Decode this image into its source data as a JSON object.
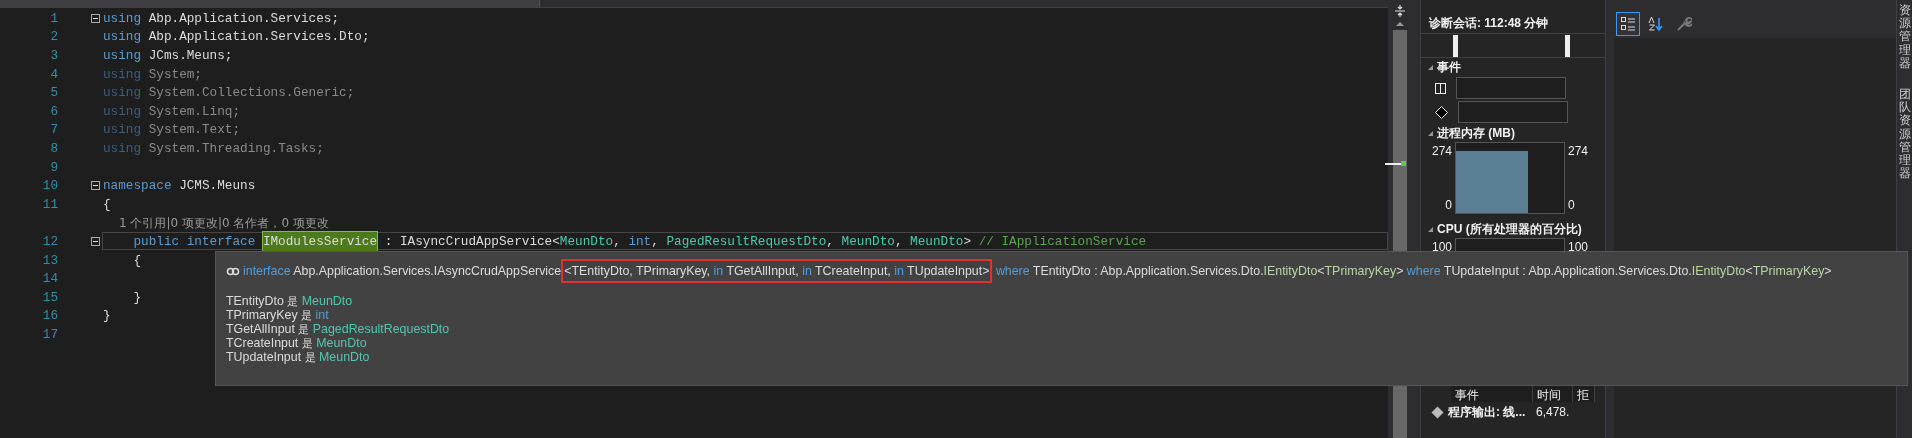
{
  "editor": {
    "lines": [
      {
        "kind": "code",
        "number": "1",
        "fold": true,
        "current": false,
        "tokens": [
          {
            "text": "using",
            "kind": "keyword"
          },
          {
            "text": " Abp.Application.Services;",
            "kind": "plain"
          }
        ]
      },
      {
        "kind": "code",
        "number": "2",
        "fold": false,
        "current": false,
        "tokens": [
          {
            "text": "using",
            "kind": "keyword"
          },
          {
            "text": " Abp.Application.Services.Dto;",
            "kind": "plain"
          }
        ]
      },
      {
        "kind": "code",
        "number": "3",
        "fold": false,
        "current": false,
        "tokens": [
          {
            "text": "using",
            "kind": "keyword"
          },
          {
            "text": " JCms.Meuns;",
            "kind": "plain"
          }
        ]
      },
      {
        "kind": "code",
        "number": "4",
        "fold": false,
        "current": false,
        "tokens": [
          {
            "text": "using",
            "kind": "keyword_dim"
          },
          {
            "text": " System;",
            "kind": "plain_dim"
          }
        ]
      },
      {
        "kind": "code",
        "number": "5",
        "fold": false,
        "current": false,
        "tokens": [
          {
            "text": "using",
            "kind": "keyword_dim"
          },
          {
            "text": " System.Collections.Generic;",
            "kind": "plain_dim"
          }
        ]
      },
      {
        "kind": "code",
        "number": "6",
        "fold": false,
        "current": false,
        "tokens": [
          {
            "text": "using",
            "kind": "keyword_dim"
          },
          {
            "text": " System.Linq;",
            "kind": "plain_dim"
          }
        ]
      },
      {
        "kind": "code",
        "number": "7",
        "fold": false,
        "current": false,
        "tokens": [
          {
            "text": "using",
            "kind": "keyword_dim"
          },
          {
            "text": " System.Text;",
            "kind": "plain_dim"
          }
        ]
      },
      {
        "kind": "code",
        "number": "8",
        "fold": false,
        "current": false,
        "tokens": [
          {
            "text": "using",
            "kind": "keyword_dim"
          },
          {
            "text": " System.Threading.Tasks;",
            "kind": "plain_dim"
          }
        ]
      },
      {
        "kind": "code",
        "number": "9",
        "fold": false,
        "current": false
      },
      {
        "kind": "code",
        "number": "10",
        "fold": true,
        "current": false,
        "tokens": [
          {
            "text": "namespace",
            "kind": "keyword"
          },
          {
            "text": " JCMS.Meuns",
            "kind": "plain"
          }
        ]
      },
      {
        "kind": "code",
        "number": "11",
        "fold": false,
        "current": false,
        "tokens": [
          {
            "text": "{",
            "kind": "plain"
          }
        ]
      },
      {
        "kind": "codelens",
        "text": "1 个引用|0 项更改|0 名作者，0 项更改"
      },
      {
        "kind": "code",
        "number": "12",
        "fold": true,
        "current": true,
        "tokens": [
          {
            "text": "    public interface ",
            "kind": "keyword"
          },
          {
            "text": "IModulesService",
            "kind": "highlight"
          },
          {
            "text": " : IAsyncCrudAppService<",
            "kind": "plain"
          },
          {
            "text": "MeunDto",
            "kind": "type"
          },
          {
            "text": ", ",
            "kind": "plain"
          },
          {
            "text": "int",
            "kind": "keyword"
          },
          {
            "text": ", ",
            "kind": "plain"
          },
          {
            "text": "PagedResultRequestDto",
            "kind": "type"
          },
          {
            "text": ", ",
            "kind": "plain"
          },
          {
            "text": "MeunDto",
            "kind": "type"
          },
          {
            "text": ", ",
            "kind": "plain"
          },
          {
            "text": "MeunDto",
            "kind": "type"
          },
          {
            "text": "> ",
            "kind": "plain"
          },
          {
            "text": "// IApplicationService",
            "kind": "comment"
          }
        ]
      },
      {
        "kind": "code",
        "number": "13",
        "fold": false,
        "current": false,
        "tokens": [
          {
            "text": "    {",
            "kind": "plain"
          }
        ]
      },
      {
        "kind": "code",
        "number": "14",
        "fold": false,
        "current": false
      },
      {
        "kind": "code",
        "number": "15",
        "fold": false,
        "current": false,
        "tokens": [
          {
            "text": "    }",
            "kind": "plain"
          }
        ]
      },
      {
        "kind": "code",
        "number": "16",
        "fold": false,
        "current": false,
        "tokens": [
          {
            "text": "}",
            "kind": "plain"
          }
        ]
      },
      {
        "kind": "code",
        "number": "17",
        "fold": false,
        "current": false
      }
    ]
  },
  "tooltip": {
    "prefix": [
      {
        "text": "interface ",
        "kind": "keyword"
      },
      {
        "text": "Abp.Application.Services.IAsyncCrudAppService",
        "kind": "plain"
      }
    ],
    "highlighted": [
      {
        "text": "<TEntityDto, TPrimaryKey, ",
        "kind": "plain"
      },
      {
        "text": "in ",
        "kind": "keyword"
      },
      {
        "text": "TGetAllInput, ",
        "kind": "plain"
      },
      {
        "text": "in ",
        "kind": "keyword"
      },
      {
        "text": "TCreateInput, ",
        "kind": "plain"
      },
      {
        "text": "in ",
        "kind": "keyword"
      },
      {
        "text": "TUpdateInput>",
        "kind": "plain"
      }
    ],
    "suffix": [
      {
        "text": " where ",
        "kind": "keyword"
      },
      {
        "text": "TEntityDto : Abp.Application.Services.Dto.",
        "kind": "plain"
      },
      {
        "text": "IEntityDto",
        "kind": "interface"
      },
      {
        "text": "<",
        "kind": "plain"
      },
      {
        "text": "TPrimaryKey",
        "kind": "interface"
      },
      {
        "text": ">",
        "kind": "plain"
      },
      {
        "text": " where ",
        "kind": "keyword"
      },
      {
        "text": "TUpdateInput : Abp.Application.Services.Dto.",
        "kind": "plain"
      },
      {
        "text": "IEntityDto",
        "kind": "interface"
      },
      {
        "text": "<",
        "kind": "plain"
      },
      {
        "text": "TPrimaryKey",
        "kind": "interface"
      },
      {
        "text": ">",
        "kind": "plain"
      }
    ],
    "mappings": [
      {
        "param": "TEntityDto",
        "word": "是",
        "type": "MeunDto",
        "kind": "type"
      },
      {
        "param": "TPrimaryKey",
        "word": "是",
        "type": "int",
        "kind": "keyword"
      },
      {
        "param": "TGetAllInput",
        "word": "是",
        "type": "PagedResultRequestDto",
        "kind": "type"
      },
      {
        "param": "TCreateInput",
        "word": "是",
        "type": "MeunDto",
        "kind": "type"
      },
      {
        "param": "TUpdateInput",
        "word": "是",
        "type": "MeunDto",
        "kind": "type"
      }
    ]
  },
  "diagnostics": {
    "session": "诊断会话: 112:48 分钟",
    "events": {
      "title": "事件",
      "expanded": true
    },
    "memory": {
      "title": "进程内存 (MB)",
      "expanded": true,
      "left_max": "274",
      "left_min": "0",
      "right_max": "274",
      "right_min": "0"
    },
    "cpu": {
      "title": "CPU (所有处理器的百分比)",
      "expanded": true,
      "left_max": "100",
      "right_max": "100"
    },
    "table": {
      "columns": [
        "事件",
        "时间",
        "拒"
      ],
      "rows": [
        {
          "event": "程序输出: 线...",
          "time": "6,478."
        }
      ]
    }
  },
  "properties": {
    "toolbar": [
      {
        "kind": "categorized",
        "selected": true,
        "disabled": false
      },
      {
        "kind": "alphabetical",
        "selected": false,
        "disabled": false
      },
      {
        "kind": "property-pages",
        "selected": false,
        "disabled": true
      }
    ]
  },
  "side_tabs": [
    "资源管理器",
    "团队资源管理器"
  ]
}
